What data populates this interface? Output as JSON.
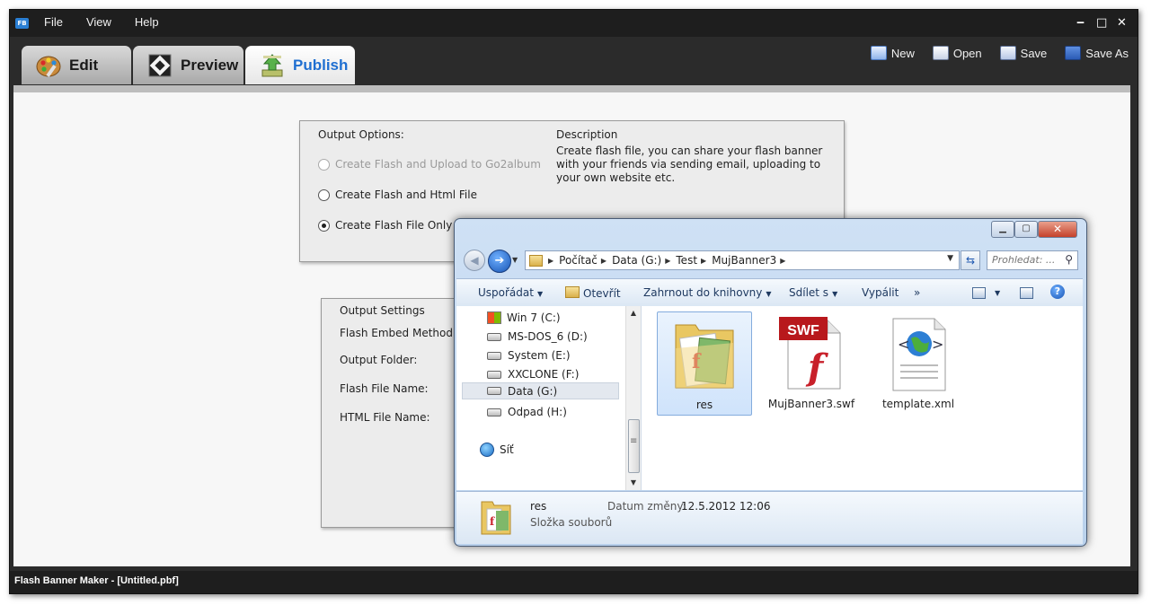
{
  "app": {
    "icon_text": "FB",
    "menu": [
      "File",
      "View",
      "Help"
    ],
    "window_controls": {
      "minimize": "‒",
      "maximize": "□",
      "close": "✕"
    },
    "tabs": [
      {
        "label": "Edit",
        "active": false
      },
      {
        "label": "Preview",
        "active": false
      },
      {
        "label": "Publish",
        "active": true
      }
    ],
    "toolbar": {
      "new": "New",
      "open": "Open",
      "save": "Save",
      "save_as": "Save As"
    },
    "status": "Flash Banner Maker - [Untitled.pbf]"
  },
  "output_options": {
    "title": "Output Options:",
    "radios": [
      {
        "label": "Create Flash and Upload to Go2album",
        "checked": false,
        "disabled": true
      },
      {
        "label": "Create Flash and Html File",
        "checked": false,
        "disabled": false
      },
      {
        "label": "Create Flash File Only",
        "checked": true,
        "disabled": false
      }
    ],
    "description_title": "Description",
    "description": "Create flash file, you can share your flash banner with your friends via sending email, uploading to your own website etc."
  },
  "output_settings": {
    "title": "Output Settings",
    "labels": [
      "Flash Embed Method:",
      "Output Folder:",
      "Flash File Name:",
      "HTML File Name:"
    ]
  },
  "explorer": {
    "window_controls": {
      "minimize": "▁",
      "maximize": "▢",
      "close": "✕"
    },
    "breadcrumb": [
      "Počítač",
      "Data (G:)",
      "Test",
      "MujBanner3"
    ],
    "search_placeholder": "Prohledat: ...",
    "commands": {
      "organize": "Uspořádat",
      "open": "Otevřít",
      "include": "Zahrnout do knihovny",
      "share": "Sdílet s",
      "burn": "Vypálit",
      "more": "»"
    },
    "nav_items": [
      "Win 7 (C:)",
      "MS-DOS_6 (D:)",
      "System (E:)",
      "XXCLONE (F:)",
      "Data (G:)",
      "Odpad (H:)"
    ],
    "selected_nav": "Data (G:)",
    "network": "Síť",
    "files": [
      {
        "name": "res",
        "type": "folder"
      },
      {
        "name": "MujBanner3.swf",
        "type": "swf",
        "badge": "SWF"
      },
      {
        "name": "template.xml",
        "type": "xml"
      }
    ],
    "details": {
      "name": "res",
      "type": "Složka souborů",
      "date_label": "Datum změny:",
      "date_value": "12.5.2012 12:06"
    }
  }
}
